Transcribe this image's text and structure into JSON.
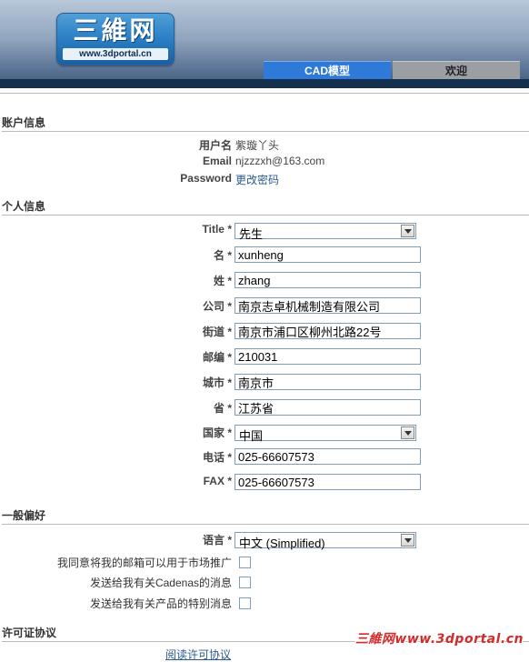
{
  "header": {
    "logo_main": "三維网",
    "logo_url": "www.3dportal.cn",
    "tabs": [
      {
        "label": "CAD模型",
        "active": true
      },
      {
        "label": "欢迎",
        "active": false
      }
    ]
  },
  "account": {
    "title": "账户信息",
    "username_label": "用户名",
    "username_value": "紫璇丫头",
    "email_label": "Email",
    "email_value": "njzzzxh@163.com",
    "password_label": "Password",
    "password_link": "更改密码"
  },
  "personal": {
    "title": "个人信息",
    "required_mark": "*",
    "title_field": {
      "label": "Title",
      "value": "先生"
    },
    "first_name": {
      "label": "名",
      "value": "xunheng"
    },
    "last_name": {
      "label": "姓",
      "value": "zhang"
    },
    "company": {
      "label": "公司",
      "value": "南京志卓机械制造有限公司"
    },
    "street": {
      "label": "街道",
      "value": "南京市浦口区柳州北路22号"
    },
    "postcode": {
      "label": "邮编",
      "value": "210031"
    },
    "city": {
      "label": "城市",
      "value": "南京市"
    },
    "province": {
      "label": "省",
      "value": "江苏省"
    },
    "country": {
      "label": "国家",
      "value": "中国"
    },
    "phone": {
      "label": "电话",
      "value": "025-66607573"
    },
    "fax": {
      "label": "FAX",
      "value": "025-66607573"
    }
  },
  "preferences": {
    "title": "一般偏好",
    "language": {
      "label": "语言",
      "value": "中文 (Simplified)"
    },
    "options": [
      {
        "label": "我同意将我的邮箱可以用于市场推广",
        "checked": false
      },
      {
        "label": "发送给我有关Cadenas的消息",
        "checked": false
      },
      {
        "label": "发送给我有关产品的特别消息",
        "checked": false
      }
    ]
  },
  "license": {
    "title": "许可证协议",
    "link_partial": "阅读许可协议"
  },
  "watermark": "三維网www.3dportal.cn"
}
